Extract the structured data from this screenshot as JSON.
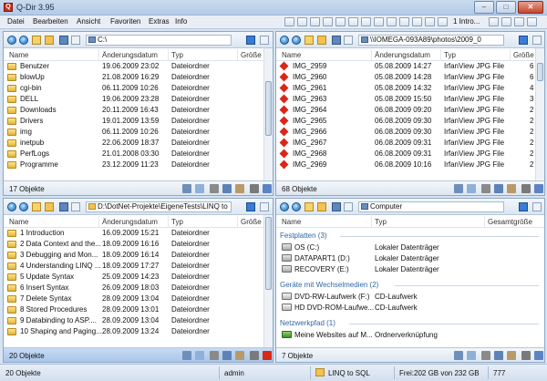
{
  "window": {
    "title": "Q-Dir 3.95",
    "minimize": "–",
    "maximize": "□",
    "close": "✕"
  },
  "menu": {
    "items": [
      "Datei",
      "Bearbeiten",
      "Ansicht",
      "Favoriten",
      "Extras",
      "Info"
    ],
    "intro_label": "1 Intro..."
  },
  "icons": {
    "app": "q-dir-app-icon",
    "back": "back-arrow-icon",
    "forward": "forward-arrow-icon",
    "up": "folder-up-icon",
    "folder": "folder-icon",
    "image": "image-file-icon",
    "drive": "hard-drive-icon",
    "computer": "computer-icon"
  },
  "panes": {
    "top_left": {
      "path": "C:\\",
      "columns": [
        "Name",
        "Änderungsdatum",
        "Typ",
        "Größe"
      ],
      "rows": [
        [
          "Benutzer",
          "19.06.2009 23:02",
          "Dateiordner"
        ],
        [
          "blowUp",
          "21.08.2009 16:29",
          "Dateiordner"
        ],
        [
          "cgi-bin",
          "06.11.2009 10:26",
          "Dateiordner"
        ],
        [
          "DELL",
          "19.06.2009 23:28",
          "Dateiordner"
        ],
        [
          "Downloads",
          "20.11.2009 16:43",
          "Dateiordner"
        ],
        [
          "Drivers",
          "19.01.2009 13:59",
          "Dateiordner"
        ],
        [
          "img",
          "06.11.2009 10:26",
          "Dateiordner"
        ],
        [
          "inetpub",
          "22.06.2009 18:37",
          "Dateiordner"
        ],
        [
          "PerfLogs",
          "21.01.2008 03:30",
          "Dateiordner"
        ],
        [
          "Programme",
          "23.12.2009 11:23",
          "Dateiordner"
        ]
      ],
      "status": "17 Objekte"
    },
    "top_right": {
      "path": "\\\\IOMEGA-093A89\\photos\\2009_0",
      "columns": [
        "Name",
        "Änderungsdatum",
        "Typ",
        "Größe"
      ],
      "rows": [
        [
          "IMG_2959",
          "05.08.2009 14:27",
          "IrfanView JPG File",
          "6"
        ],
        [
          "IMG_2960",
          "05.08.2009 14:28",
          "IrfanView JPG File",
          "6"
        ],
        [
          "IMG_2961",
          "05.08.2009 14:32",
          "IrfanView JPG File",
          "4"
        ],
        [
          "IMG_2963",
          "05.08.2009 15:50",
          "IrfanView JPG File",
          "3"
        ],
        [
          "IMG_2964",
          "06.08.2009 09:20",
          "IrfanView JPG File",
          "2"
        ],
        [
          "IMG_2965",
          "06.08.2009 09:30",
          "IrfanView JPG File",
          "2"
        ],
        [
          "IMG_2966",
          "06.08.2009 09:30",
          "IrfanView JPG File",
          "2"
        ],
        [
          "IMG_2967",
          "06.08.2009 09:31",
          "IrfanView JPG File",
          "2"
        ],
        [
          "IMG_2968",
          "06.08.2009 09:31",
          "IrfanView JPG File",
          "2"
        ],
        [
          "IMG_2969",
          "06.08.2009 10:16",
          "IrfanView JPG File",
          "2"
        ]
      ],
      "status": "68 Objekte"
    },
    "bottom_left": {
      "path": "D:\\DotNet-Projekte\\EigeneTests\\LINQ to",
      "columns": [
        "Name",
        "Änderungsdatum",
        "Typ",
        "Größe"
      ],
      "rows": [
        [
          "1 Introduction",
          "16.09.2009 15:21",
          "Dateiordner"
        ],
        [
          "2 Data Context and the...",
          "18.09.2009 16:16",
          "Dateiordner"
        ],
        [
          "3 Debugging and Mon...",
          "18.09.2009 16:14",
          "Dateiordner"
        ],
        [
          "4 Understanding LINQ ...",
          "18.09.2009 17:27",
          "Dateiordner"
        ],
        [
          "5 Update Syntax",
          "25.09.2009 14:23",
          "Dateiordner"
        ],
        [
          "6 Insert Syntax",
          "26.09.2009 18:03",
          "Dateiordner"
        ],
        [
          "7 Delete Syntax",
          "28.09.2009 13:04",
          "Dateiordner"
        ],
        [
          "8  Stored Procedures",
          "28.09.2009 13:01",
          "Dateiordner"
        ],
        [
          "9 Databinding to ASP....",
          "28.09.2009 13:04",
          "Dateiordner"
        ],
        [
          "10 Shaping and Paging...",
          "28.09.2009 13:24",
          "Dateiordner"
        ]
      ],
      "status": "20 Objekte"
    },
    "bottom_right": {
      "path": "Computer",
      "columns": [
        "Name",
        "Typ",
        "Gesamtgröße"
      ],
      "groups": [
        {
          "title": "Festplatten (3)",
          "items": [
            [
              "OS (C:)",
              "Lokaler Datenträger"
            ],
            [
              "DATAPART1 (D:)",
              "Lokaler Datenträger"
            ],
            [
              "RECOVERY (E:)",
              "Lokaler Datenträger"
            ]
          ]
        },
        {
          "title": "Geräte mit Wechselmedien (2)",
          "items": [
            [
              "DVD-RW-Laufwerk (F:)",
              "CD-Laufwerk"
            ],
            [
              "HD DVD-ROM-Laufwe...",
              "CD-Laufwerk"
            ]
          ]
        },
        {
          "title": "Netzwerkpfad (1)",
          "items": [
            [
              "Meine Websites auf M...",
              "Ordnerverknüpfung"
            ]
          ]
        }
      ],
      "status": "7 Objekte"
    }
  },
  "statusbar": {
    "objects": "20 Objekte",
    "user": "admin",
    "folder": "LINQ to SQL",
    "free": "Frei:202 GB von 232 GB",
    "number": "777"
  }
}
